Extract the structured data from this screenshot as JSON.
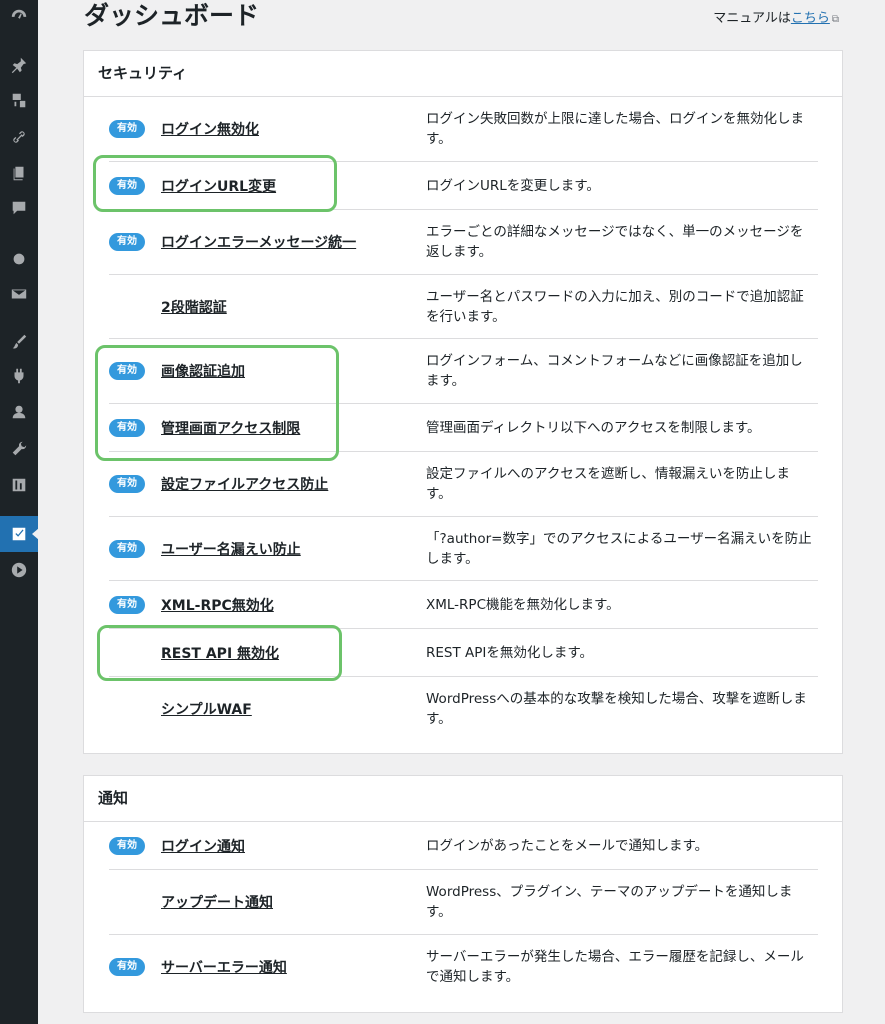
{
  "sidebar": {
    "icons": [
      "dashboard-icon",
      "pin-icon",
      "media-icon",
      "link-icon",
      "pages-icon",
      "comments-icon",
      "circle-icon",
      "mail-icon",
      "brush-icon",
      "plugin-icon",
      "user-icon",
      "wrench-icon",
      "settings-sliders-icon",
      "security-shield-icon",
      "play-icon"
    ],
    "active": "security-shield-icon"
  },
  "header": {
    "title": "ダッシュボード",
    "manual_prefix": "マニュアルは",
    "manual_link": "こちら"
  },
  "security": {
    "title": "セキュリティ",
    "badge_label": "有効",
    "items": [
      {
        "name": "ログイン無効化",
        "desc": "ログイン失敗回数が上限に達した場合、ログインを無効化します。",
        "enabled": true
      },
      {
        "name": "ログインURL変更",
        "desc": "ログインURLを変更します。",
        "enabled": true
      },
      {
        "name": "ログインエラーメッセージ統一",
        "desc": "エラーごとの詳細なメッセージではなく、単一のメッセージを返します。",
        "enabled": true
      },
      {
        "name": "2段階認証",
        "desc": "ユーザー名とパスワードの入力に加え、別のコードで追加認証を行います。",
        "enabled": false
      },
      {
        "name": "画像認証追加",
        "desc": "ログインフォーム、コメントフォームなどに画像認証を追加します。",
        "enabled": true
      },
      {
        "name": "管理画面アクセス制限",
        "desc": "管理画面ディレクトリ以下へのアクセスを制限します。",
        "enabled": true
      },
      {
        "name": "設定ファイルアクセス防止",
        "desc": "設定ファイルへのアクセスを遮断し、情報漏えいを防止します。",
        "enabled": true
      },
      {
        "name": "ユーザー名漏えい防止",
        "desc": "「?author=数字」でのアクセスによるユーザー名漏えいを防止します。",
        "enabled": true
      },
      {
        "name": "XML-RPC無効化",
        "desc": "XML-RPC機能を無効化します。",
        "enabled": true
      },
      {
        "name": "REST API 無効化",
        "desc": "REST APIを無効化します。",
        "enabled": false
      },
      {
        "name": "シンプルWAF",
        "desc": "WordPressへの基本的な攻撃を検知した場合、攻撃を遮断します。",
        "enabled": false
      }
    ]
  },
  "notify": {
    "title": "通知",
    "badge_label": "有効",
    "items": [
      {
        "name": "ログイン通知",
        "desc": "ログインがあったことをメールで通知します。",
        "enabled": true
      },
      {
        "name": "アップデート通知",
        "desc": "WordPress、プラグイン、テーマのアップデートを通知します。",
        "enabled": false
      },
      {
        "name": "サーバーエラー通知",
        "desc": "サーバーエラーが発生した場合、エラー履歴を記録し、メールで通知します。",
        "enabled": true
      }
    ]
  },
  "colors": {
    "badge": "#3399dd",
    "highlight": "#6cc36a",
    "sidebar_bg": "#1d2327",
    "active": "#2271b1"
  }
}
